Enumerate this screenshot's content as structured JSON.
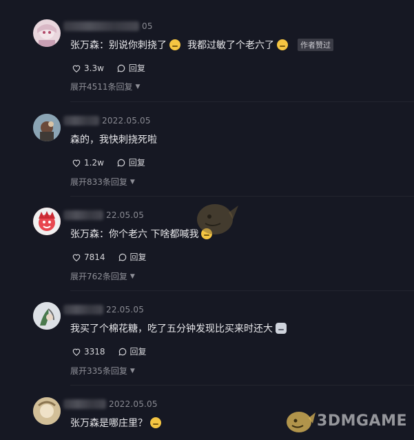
{
  "comments": [
    {
      "date": "05",
      "text_parts": [
        "张万森：别说你刺挠了",
        "我都过敏了个老六了"
      ],
      "author_badge": "作者赞过",
      "likes": "3.3w",
      "reply_label": "回复",
      "expand_label": "展开4511条回复",
      "avatar_color": "#e9d6dd"
    },
    {
      "date": "2022.05.05",
      "text_parts": [
        "森的，我快刺挠死啦"
      ],
      "likes": "1.2w",
      "reply_label": "回复",
      "expand_label": "展开833条回复",
      "avatar_color": "#7a96a8"
    },
    {
      "date": "22.05.05",
      "text_parts": [
        "张万森：你个老六 下啥都喊我"
      ],
      "likes": "7814",
      "reply_label": "回复",
      "expand_label": "展开762条回复",
      "avatar_color": "#e8474f"
    },
    {
      "date": "22.05.05",
      "text_parts": [
        "我买了个棉花糖，吃了五分钟发现比买来时还大"
      ],
      "likes": "3318",
      "reply_label": "回复",
      "expand_label": "展开335条回复",
      "avatar_color": "#d7dbe0"
    },
    {
      "date": "2022.05.05",
      "text_parts": [
        "张万森是哪庄里？"
      ],
      "avatar_color": "#c8b48c"
    }
  ],
  "watermark": {
    "text": "3DMGAME"
  }
}
